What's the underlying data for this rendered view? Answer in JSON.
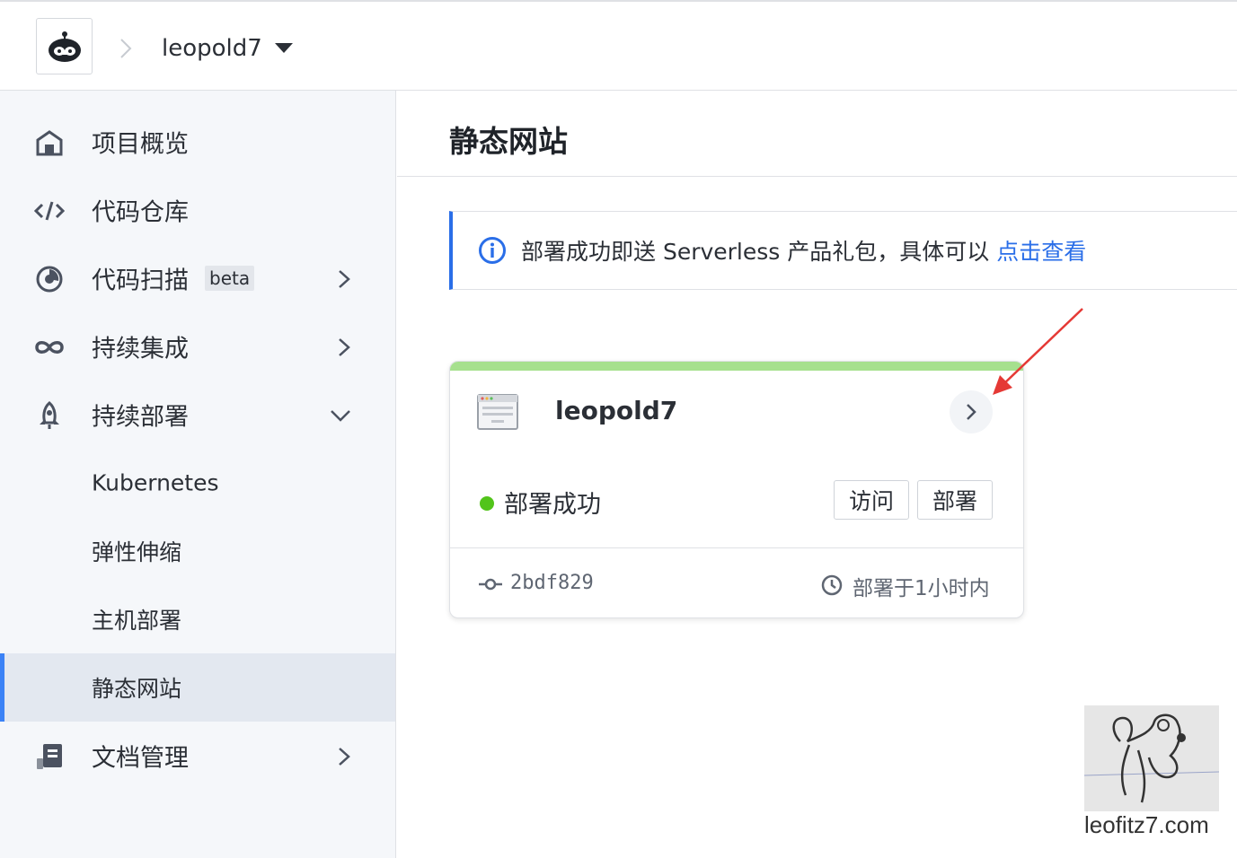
{
  "header": {
    "project_name": "leopold7",
    "logo_icon": "coding-monkey-logo-icon"
  },
  "sidebar": {
    "items": [
      {
        "label": "项目概览",
        "icon": "home-icon"
      },
      {
        "label": "代码仓库",
        "icon": "code-icon"
      },
      {
        "label": "代码扫描",
        "icon": "scan-icon",
        "badge": "beta",
        "expand": "chevron-right-icon"
      },
      {
        "label": "持续集成",
        "icon": "infinity-icon",
        "expand": "chevron-right-icon"
      },
      {
        "label": "持续部署",
        "icon": "rocket-icon",
        "expand": "chevron-down-icon"
      },
      {
        "label": "Kubernetes"
      },
      {
        "label": "弹性伸缩"
      },
      {
        "label": "主机部署"
      },
      {
        "label": "静态网站",
        "active": true
      },
      {
        "label": "文档管理",
        "icon": "document-icon",
        "expand": "chevron-right-icon"
      }
    ]
  },
  "main": {
    "title": "静态网站",
    "notice": {
      "text": "部署成功即送 Serverless 产品礼包，具体可以",
      "link": "点击查看",
      "icon": "info-icon"
    },
    "site_card": {
      "name": "leopold7",
      "status": "部署成功",
      "status_color": "#52c41a",
      "accent_color": "#a6e08e",
      "visit_label": "访问",
      "deploy_label": "部署",
      "commit": "2bdf829",
      "deployed_time": "部署于1小时内"
    }
  },
  "watermark": {
    "text": "leofitz7.com"
  },
  "colors": {
    "accent": "#2a6ee8",
    "sidebar_bg": "#f5f7fa",
    "active_bar": "#3b82f6",
    "annotation_arrow": "#e53935"
  }
}
